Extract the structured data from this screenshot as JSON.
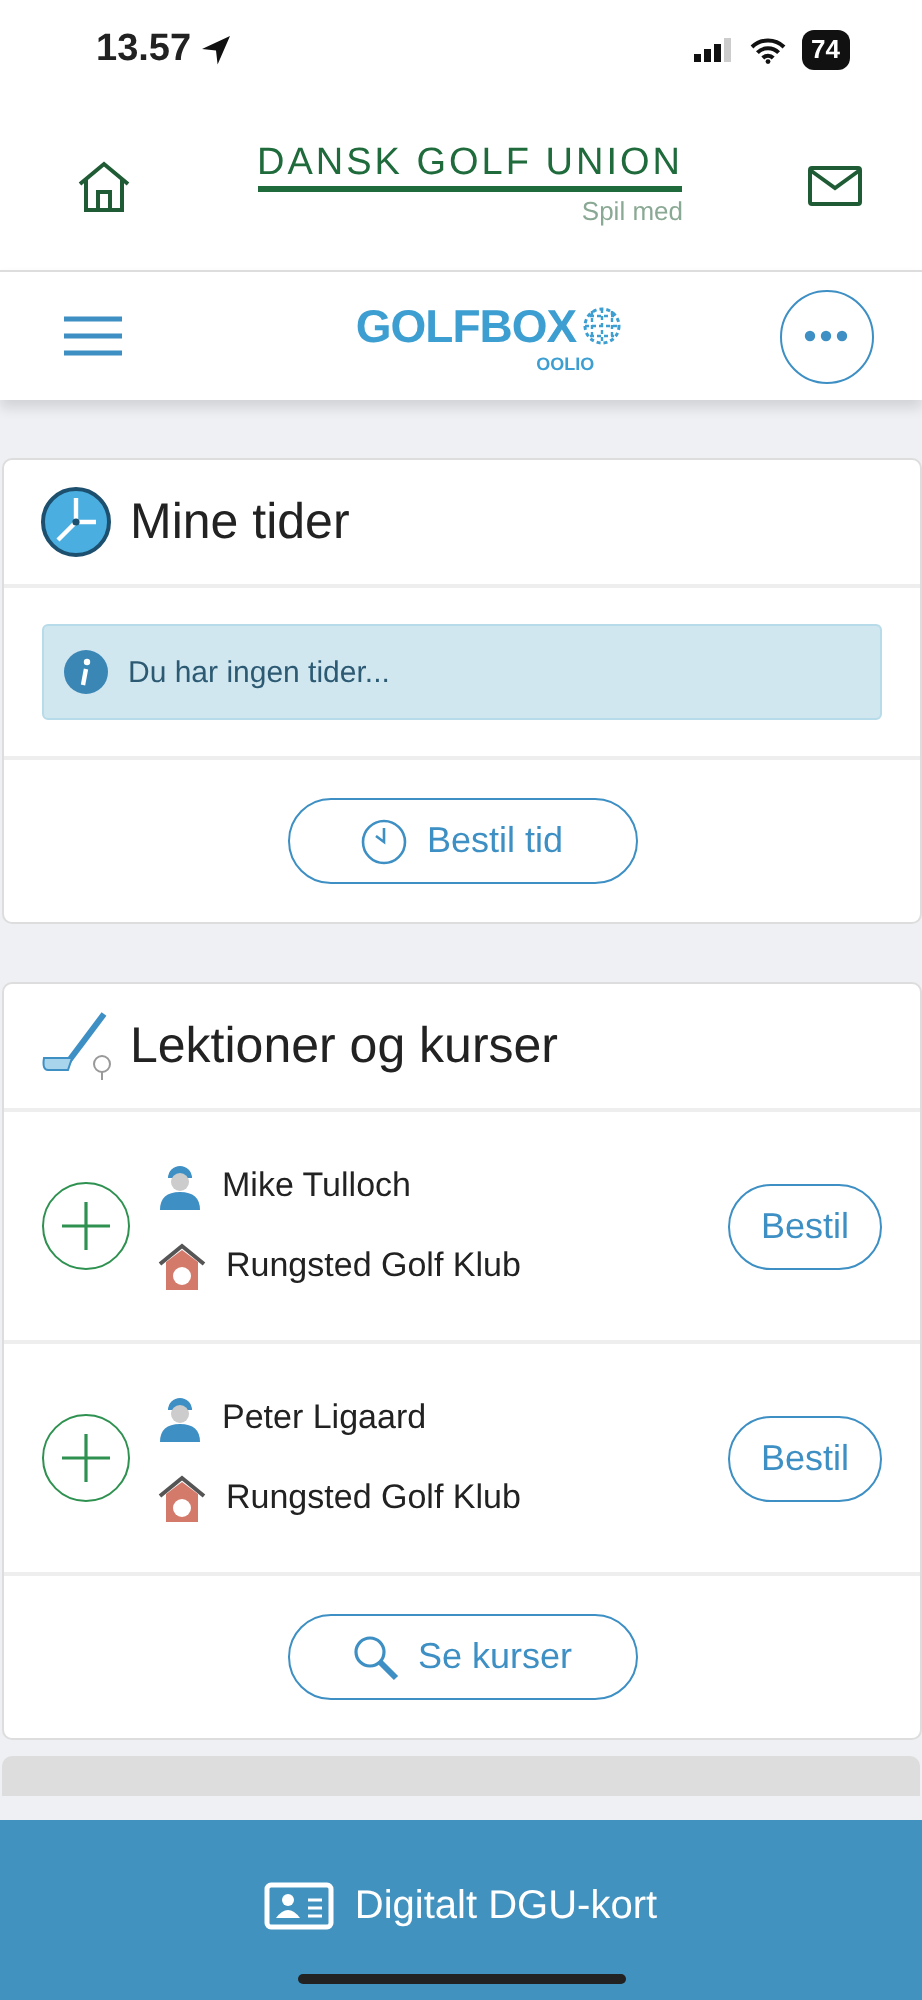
{
  "status_bar": {
    "time": "13.57",
    "battery": "74"
  },
  "header": {
    "logo_title": "DANSK GOLF UNION",
    "logo_tagline": "Spil med"
  },
  "nav": {
    "brand": "GOLFBOX",
    "brand_sub": "OOLIO"
  },
  "times_card": {
    "title": "Mine tider",
    "info": "Du har ingen tider...",
    "button": "Bestil tid"
  },
  "lessons_card": {
    "title": "Lektioner og kurser",
    "instructors": [
      {
        "name": "Mike Tulloch",
        "club": "Rungsted Golf Klub",
        "button": "Bestil"
      },
      {
        "name": "Peter Ligaard",
        "club": "Rungsted Golf Klub",
        "button": "Bestil"
      }
    ],
    "button": "Se kurser"
  },
  "bottom_bar": {
    "label": "Digitalt DGU-kort"
  }
}
